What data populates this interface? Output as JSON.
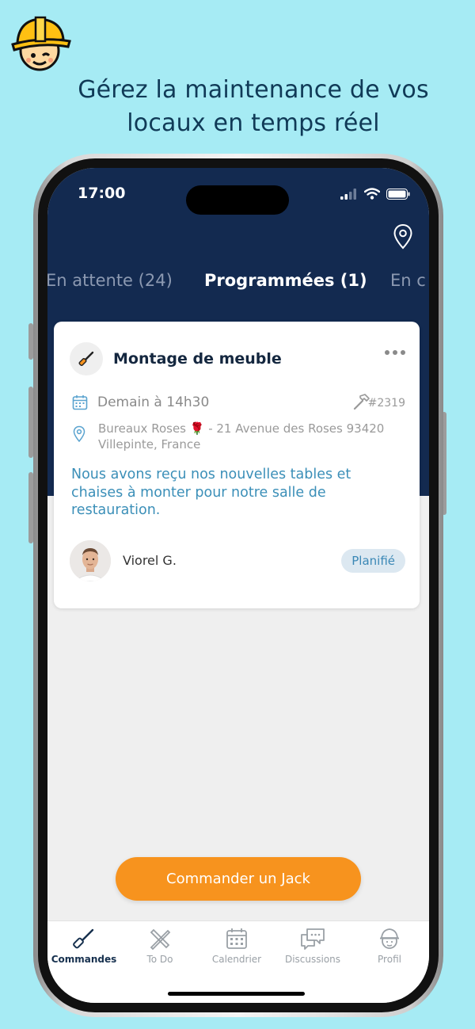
{
  "headline": "Gérez la maintenance de vos locaux en temps réel",
  "headline_line1": "Gérez la maintenance de vos",
  "headline_line2": "locaux en temps réel",
  "status_bar": {
    "time": "17:00"
  },
  "tabs": [
    {
      "label": "En attente (24)",
      "active": false
    },
    {
      "label": "Programmées (1)",
      "active": true
    },
    {
      "label": "En c",
      "active": false
    }
  ],
  "card": {
    "title": "Montage de meuble",
    "date": "Demain à 14h30",
    "reference": "#2319",
    "address_line1": "Bureaux Roses 🌹 - 21 Avenue des Roses 93420",
    "address_line2": "Villepinte, France",
    "description": "Nous avons reçu nos nouvelles tables et chaises à monter pour notre salle de restauration.",
    "worker_name": "Viorel G.",
    "status": "Planifié"
  },
  "cta_label": "Commander un Jack",
  "tabbar": [
    {
      "label": "Commandes",
      "icon": "screwdriver-icon",
      "active": true
    },
    {
      "label": "To Do",
      "icon": "tools-icon",
      "active": false
    },
    {
      "label": "Calendrier",
      "icon": "calendar-icon",
      "active": false
    },
    {
      "label": "Discussions",
      "icon": "chat-icon",
      "active": false
    },
    {
      "label": "Profil",
      "icon": "worker-icon",
      "active": false
    }
  ],
  "colors": {
    "background": "#a6ebf4",
    "header": "#132a50",
    "accent": "#f7931e",
    "description_text": "#3b8fb8",
    "badge_bg": "#dce8f1"
  }
}
